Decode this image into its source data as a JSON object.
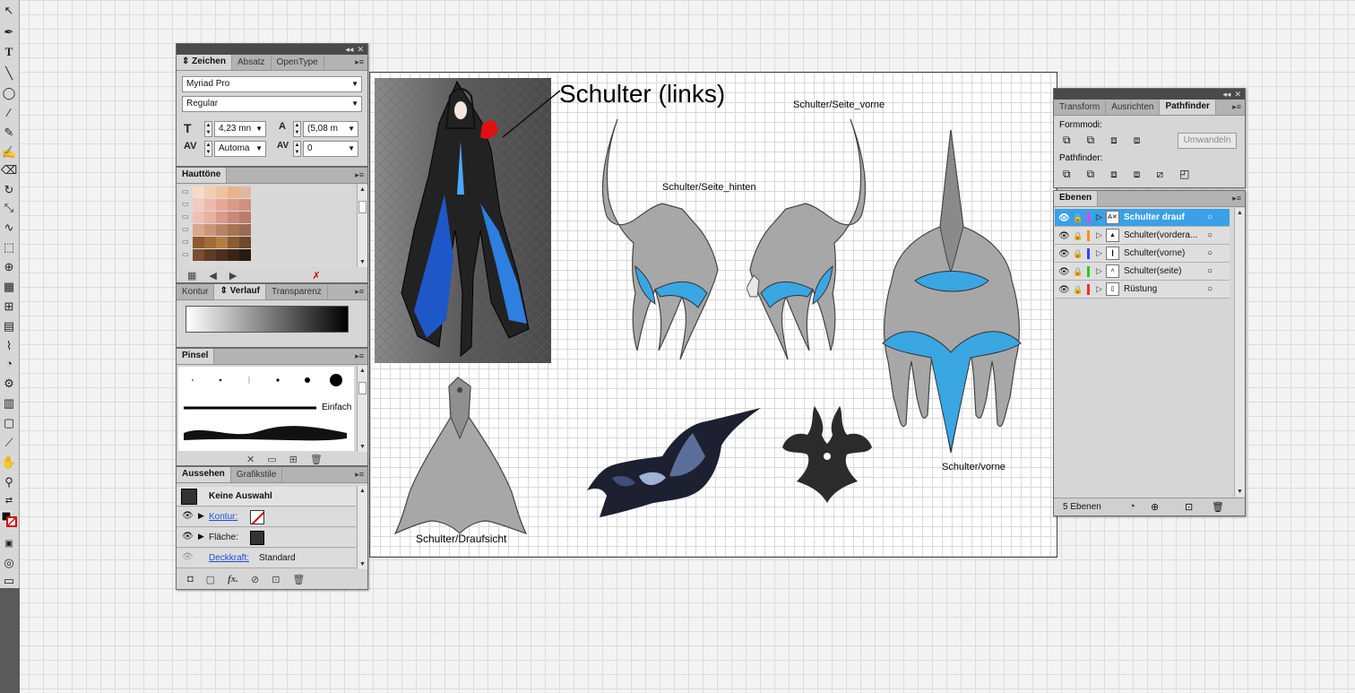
{
  "toolbar": {
    "icons": [
      "selection-icon",
      "pen-icon",
      "type-icon",
      "line-icon",
      "ellipse-icon",
      "paintbrush-icon",
      "pencil-icon",
      "eraser-icon",
      "rotate-icon",
      "scale-icon",
      "warp-icon",
      "free-transform-icon",
      "symbol-sprayer-icon",
      "graph-icon",
      "mesh-icon",
      "gradient-icon",
      "eyedropper-icon",
      "blend-icon",
      "symbol-icon",
      "bar-graph-icon",
      "artboard-icon",
      "slice-icon",
      "hand-icon",
      "zoom-icon"
    ]
  },
  "character_panel": {
    "tabs": [
      "Zeichen",
      "Absatz",
      "OpenType"
    ],
    "active_tab": "Zeichen",
    "font_family": "Myriad Pro",
    "font_style": "Regular",
    "font_size": "4,23 mn",
    "leading": "(5,08 m",
    "kerning": "Automa",
    "tracking": "0"
  },
  "swatches_panel": {
    "title": "Hauttöne",
    "swatch_colors": [
      [
        "#f7dcc8",
        "#f2cfb4",
        "#edc3a0",
        "#e6b48c",
        "#ddb9a4"
      ],
      [
        "#f4c9be",
        "#eeb9ad",
        "#e6a898",
        "#dc9a89",
        "#d08f80"
      ],
      [
        "#f0c0b2",
        "#e7b0a1",
        "#d99b8a",
        "#c98a7a",
        "#bb7c6d"
      ],
      [
        "#d9a88a",
        "#c99678",
        "#b98466",
        "#a97355",
        "#9a6a58"
      ],
      [
        "#8f5a2c",
        "#a26a37",
        "#b67d43",
        "#8b5a33",
        "#6d4a2e"
      ],
      [
        "#7a4e30",
        "#5e3c26",
        "#4c2f1e",
        "#3a2417",
        "#2a1a10"
      ]
    ]
  },
  "gradient_panel": {
    "tabs": [
      "Kontur",
      "Verlauf",
      "Transparenz"
    ],
    "active_tab": "Verlauf"
  },
  "brushes_panel": {
    "title": "Pinsel",
    "stroke_label": "Einfach"
  },
  "appearance_panel": {
    "tabs": [
      "Aussehen",
      "Grafikstile"
    ],
    "active_tab": "Aussehen",
    "selection": "Keine Auswahl",
    "stroke_label": "Kontur:",
    "fill_label": "Fläche:",
    "opacity_label": "Deckkraft:",
    "opacity_value": "Standard"
  },
  "artboard": {
    "callout": "Schulter (links)",
    "labels": {
      "seite_vorne": "Schulter/Seite_vorne",
      "seite_hinten": "Schulter/Seite_hinten",
      "vorne": "Schulter/vorne",
      "draufsicht": "Schulter/Draufsicht"
    },
    "colors": {
      "armor_grey": "#a9a9a9",
      "accent_blue": "#39a9e0",
      "dark": "#2b2b2b",
      "highlight_red": "#e01010"
    }
  },
  "pathfinder_panel": {
    "tabs": [
      "Transform",
      "Ausrichten",
      "Pathfinder"
    ],
    "active_tab": "Pathfinder",
    "shape_modes_label": "Formmodi:",
    "pathfinders_label": "Pathfinder:",
    "expand_button": "Umwandeln"
  },
  "layers_panel": {
    "title": "Ebenen",
    "layers": [
      {
        "name": "Schulter drauf",
        "color": "#ff3ee0",
        "thumb": "A✕",
        "selected": true
      },
      {
        "name": "Schulter(vordera...",
        "color": "#ff8c1a",
        "thumb": "▲",
        "selected": false
      },
      {
        "name": "Schulter(vorne)",
        "color": "#3c3cff",
        "thumb": "❙",
        "selected": false
      },
      {
        "name": "Schulter(seite)",
        "color": "#22cc22",
        "thumb": "˄",
        "selected": false
      },
      {
        "name": "Rüstung",
        "color": "#ff2a2a",
        "thumb": "▯",
        "selected": false
      }
    ],
    "count": "5 Ebenen"
  }
}
